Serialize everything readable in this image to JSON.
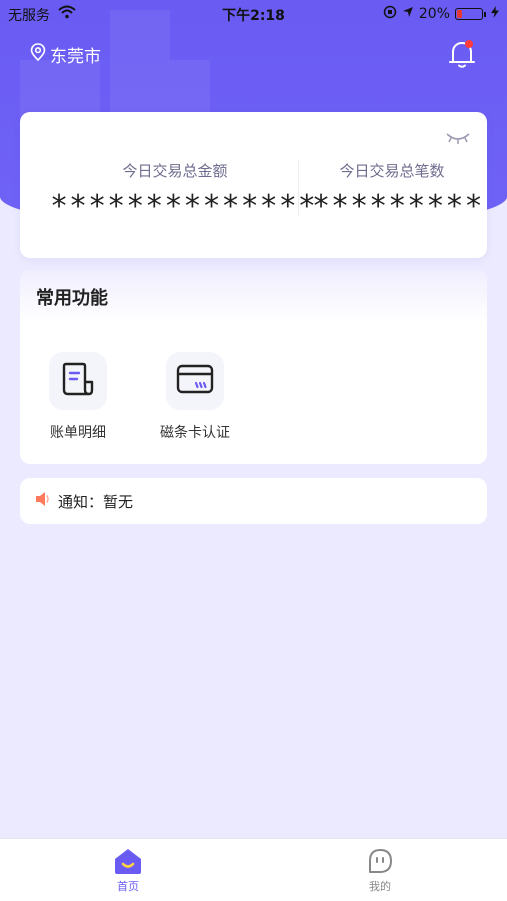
{
  "status_bar": {
    "carrier": "无服务",
    "time": "下午2:18",
    "battery": "20%",
    "battery_level": 0.2
  },
  "header": {
    "location": "东莞市",
    "icons": {
      "location": "location-pin-icon",
      "bell": "bell-icon"
    }
  },
  "stats": {
    "left_label": "今日交易总金额",
    "left_value": "**************",
    "right_label": "今日交易总笔数",
    "right_value": "*********"
  },
  "functions": {
    "title": "常用功能",
    "items": [
      {
        "label": "账单明细",
        "icon": "bill-icon"
      },
      {
        "label": "磁条卡认证",
        "icon": "card-icon"
      }
    ]
  },
  "notice": {
    "text": "通知：暂无",
    "icon": "speaker-icon"
  },
  "tab_bar": {
    "tabs": [
      {
        "label": "首页",
        "icon": "home-icon",
        "active": true
      },
      {
        "label": "我的",
        "icon": "profile-icon",
        "active": false
      }
    ]
  },
  "colors": {
    "primary": "#6a5cf3",
    "background": "#ebeafe",
    "notice_icon": "#ff7a5a",
    "alert_dot": "#ff3b3b"
  }
}
